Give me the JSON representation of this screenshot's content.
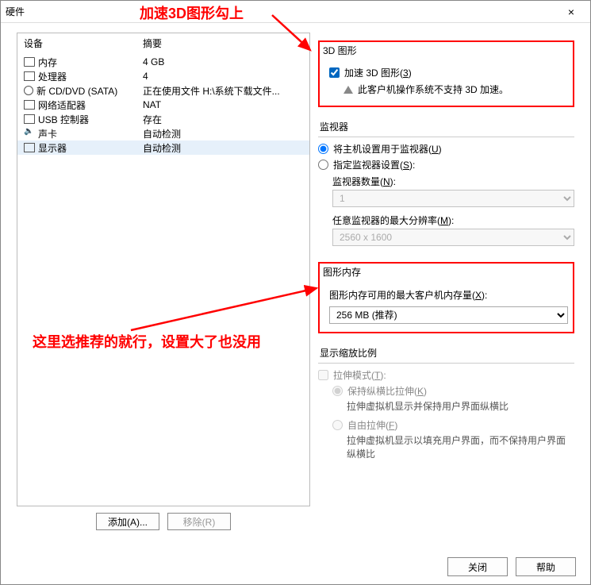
{
  "window": {
    "title": "硬件",
    "close_btn": "×"
  },
  "annotations": {
    "top_note": "加速3D图形勾上",
    "bottom_note": "这里选推荐的就行，设置大了也没用"
  },
  "device_table": {
    "header_device": "设备",
    "header_summary": "摘要",
    "rows": [
      {
        "name": "内存",
        "summary": "4 GB"
      },
      {
        "name": "处理器",
        "summary": "4"
      },
      {
        "name": "新 CD/DVD (SATA)",
        "summary": "正在使用文件 H:\\系统下载文件..."
      },
      {
        "name": "网络适配器",
        "summary": "NAT"
      },
      {
        "name": "USB 控制器",
        "summary": "存在"
      },
      {
        "name": "声卡",
        "summary": "自动检测"
      },
      {
        "name": "显示器",
        "summary": "自动检测"
      }
    ]
  },
  "buttons": {
    "add": "添加(A)...",
    "remove": "移除(R)",
    "close": "关闭",
    "help": "帮助"
  },
  "d3": {
    "title": "3D 图形",
    "accel_label_pre": "加速 3D 图形(",
    "accel_label_key": "3",
    "accel_label_post": ")",
    "warn": "此客户机操作系统不支持 3D 加速。"
  },
  "monitor": {
    "title": "监视器",
    "use_host_pre": "将主机设置用于监视器(",
    "use_host_key": "U",
    "use_host_post": ")",
    "specify_pre": "指定监视器设置(",
    "specify_key": "S",
    "specify_post": "):",
    "count_label_pre": "监视器数量(",
    "count_label_key": "N",
    "count_label_post": "):",
    "count_value": "1",
    "maxres_label_pre": "任意监视器的最大分辨率(",
    "maxres_label_key": "M",
    "maxres_label_post": "):",
    "maxres_value": "2560 x 1600"
  },
  "vram": {
    "title": "图形内存",
    "label_pre": "图形内存可用的最大客户机内存量(",
    "label_key": "X",
    "label_post": "):",
    "value": "256 MB (推荐)"
  },
  "scale": {
    "title": "显示缩放比例",
    "stretch_mode_pre": "拉伸模式(",
    "stretch_mode_key": "T",
    "stretch_mode_post": "):",
    "keep_ratio_pre": "保持纵横比拉伸(",
    "keep_ratio_key": "K",
    "keep_ratio_post": ")",
    "keep_ratio_hint": "拉伸虚拟机显示并保持用户界面纵横比",
    "free_pre": "自由拉伸(",
    "free_key": "F",
    "free_post": ")",
    "free_hint": "拉伸虚拟机显示以填充用户界面，而不保持用户界面纵横比"
  }
}
